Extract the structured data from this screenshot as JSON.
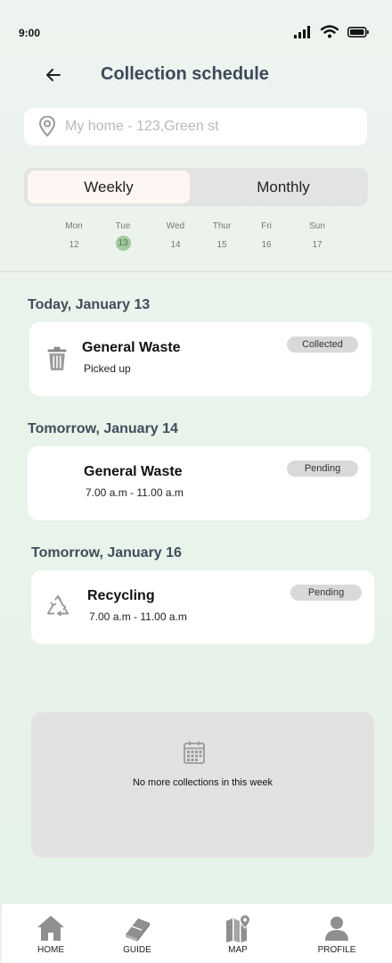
{
  "status": {
    "time": "9:00"
  },
  "header": {
    "title": "Collection schedule"
  },
  "location": {
    "placeholder": "My home - 123,Green st"
  },
  "toggle": {
    "weekly": "Weekly",
    "monthly": "Monthly",
    "selected": "Weekly"
  },
  "days": [
    {
      "name": "Mon",
      "num": "12"
    },
    {
      "name": "Tue",
      "num": "13",
      "active": true
    },
    {
      "name": "Wed",
      "num": "14"
    },
    {
      "name": "Thur",
      "num": "15"
    },
    {
      "name": "Fri",
      "num": "16"
    },
    {
      "name": "Sun",
      "num": "17"
    }
  ],
  "sections": [
    {
      "title": "Today, January 13",
      "card": {
        "title": "General Waste",
        "sub": "Picked up",
        "badge": "Collected",
        "icon": "trash-icon"
      }
    },
    {
      "title": "Tomorrow, January 14",
      "card": {
        "title": "General Waste",
        "sub": "7.00 a.m - 11.00 a.m",
        "badge": "Pending",
        "icon": ""
      }
    },
    {
      "title": "Tomorrow, January 16",
      "card": {
        "title": "Recycling",
        "sub": "7.00 a.m - 11.00 a.m",
        "badge": "Pending",
        "icon": "recycle-icon"
      }
    }
  ],
  "empty": {
    "text": "No more collections in this week",
    "icon": "calendar-icon"
  },
  "nav": [
    {
      "label": "HOME",
      "icon": "home-icon"
    },
    {
      "label": "GUIDE",
      "icon": "book-icon"
    },
    {
      "label": "MAP",
      "icon": "map-icon"
    },
    {
      "label": "PROFILE",
      "icon": "profile-icon"
    }
  ],
  "colors": {
    "accent": "#a3c9a0",
    "title": "#3c4a5a",
    "badge": "#d9d9d9"
  }
}
